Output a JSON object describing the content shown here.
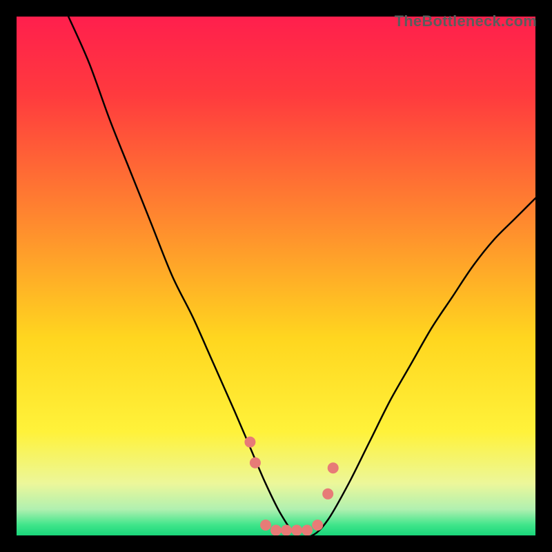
{
  "watermark": "TheBottleneck.com",
  "chart_data": {
    "type": "line",
    "title": "",
    "xlabel": "",
    "ylabel": "",
    "xlim": [
      0,
      100
    ],
    "ylim": [
      0,
      100
    ],
    "grid": false,
    "legend": false,
    "series": [
      {
        "name": "curve",
        "x": [
          10,
          14,
          18,
          22,
          26,
          30,
          34,
          38,
          42,
          45,
          48,
          51,
          54,
          57,
          60,
          64,
          68,
          72,
          76,
          80,
          84,
          88,
          92,
          96,
          100
        ],
        "y": [
          100,
          91,
          80,
          70,
          60,
          50,
          42,
          33,
          24,
          17,
          10,
          4,
          0,
          0,
          3,
          10,
          18,
          26,
          33,
          40,
          46,
          52,
          57,
          61,
          65
        ]
      },
      {
        "name": "markers",
        "x": [
          45,
          46,
          48,
          50,
          52,
          54,
          56,
          58,
          60,
          61
        ],
        "y": [
          18,
          14,
          2,
          1,
          1,
          1,
          1,
          2,
          8,
          13
        ]
      }
    ],
    "background_gradient": {
      "stops": [
        {
          "offset": 0.0,
          "color": "#ff1f4d"
        },
        {
          "offset": 0.15,
          "color": "#ff3a3e"
        },
        {
          "offset": 0.4,
          "color": "#ff8b2e"
        },
        {
          "offset": 0.62,
          "color": "#ffd61f"
        },
        {
          "offset": 0.8,
          "color": "#fff23a"
        },
        {
          "offset": 0.9,
          "color": "#ecf79a"
        },
        {
          "offset": 0.95,
          "color": "#b0f0b0"
        },
        {
          "offset": 0.98,
          "color": "#3fe58a"
        },
        {
          "offset": 1.0,
          "color": "#19d67a"
        }
      ]
    },
    "marker_color": "#e77b77",
    "curve_color": "#000000"
  }
}
